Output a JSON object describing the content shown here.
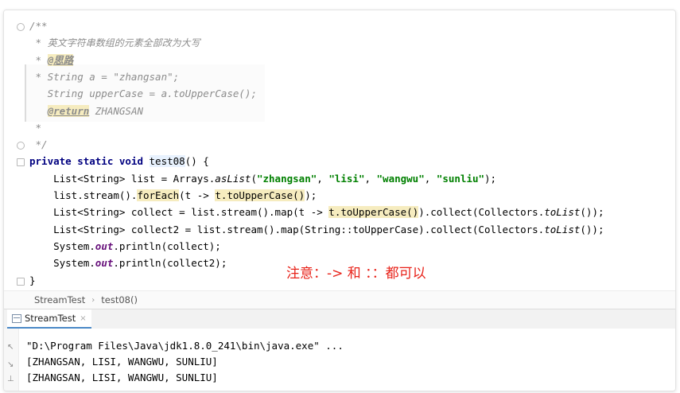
{
  "editor": {
    "lines": [
      {
        "parts": [
          {
            "t": "/**",
            "c": "doc"
          }
        ]
      },
      {
        "parts": [
          {
            "t": " * ",
            "c": "doc"
          },
          {
            "t": "英文字符串数组的元素全部改为大写",
            "c": "doc-cn"
          }
        ]
      },
      {
        "parts": [
          {
            "t": " * ",
            "c": "doc"
          },
          {
            "t": "@思路",
            "c": "doc-tag"
          }
        ]
      },
      {
        "parts": [
          {
            "t": " * String a = \"zhangsan\";",
            "c": "doc-code"
          }
        ]
      },
      {
        "parts": [
          {
            "t": "   String upperCase = a.toUpperCase();",
            "c": "doc-code"
          }
        ]
      },
      {
        "parts": [
          {
            "t": "   ",
            "c": "doc"
          },
          {
            "t": "@return",
            "c": "doc-tag"
          },
          {
            "t": " ZHANGSAN",
            "c": "doc"
          }
        ]
      },
      {
        "parts": [
          {
            "t": " *",
            "c": "doc"
          }
        ]
      },
      {
        "parts": [
          {
            "t": " */",
            "c": "doc"
          }
        ]
      },
      {
        "parts": [
          {
            "t": "private static void ",
            "c": "kw"
          },
          {
            "t": "test08",
            "c": "hl-m"
          },
          {
            "t": "() {",
            "c": ""
          }
        ]
      },
      {
        "parts": [
          {
            "t": "    List<String> list = Arrays.",
            "c": ""
          },
          {
            "t": "asList",
            "c": "static-m"
          },
          {
            "t": "(",
            "c": ""
          },
          {
            "t": "\"zhangsan\"",
            "c": "str"
          },
          {
            "t": ", ",
            "c": ""
          },
          {
            "t": "\"lisi\"",
            "c": "str"
          },
          {
            "t": ", ",
            "c": ""
          },
          {
            "t": "\"wangwu\"",
            "c": "str"
          },
          {
            "t": ", ",
            "c": ""
          },
          {
            "t": "\"sunliu\"",
            "c": "str"
          },
          {
            "t": ");",
            "c": ""
          }
        ]
      },
      {
        "parts": [
          {
            "t": "    list.stream().",
            "c": ""
          },
          {
            "t": "forEach",
            "c": "hl"
          },
          {
            "t": "(t -> ",
            "c": ""
          },
          {
            "t": "t.toUpperCase()",
            "c": "hl"
          },
          {
            "t": ");",
            "c": ""
          }
        ]
      },
      {
        "parts": [
          {
            "t": "    List<String> collect = list.stream().map(t -> ",
            "c": ""
          },
          {
            "t": "t.toUpperCase()",
            "c": "hl"
          },
          {
            "t": ").collect(Collectors.",
            "c": ""
          },
          {
            "t": "toList",
            "c": "static-m"
          },
          {
            "t": "());",
            "c": ""
          }
        ]
      },
      {
        "parts": [
          {
            "t": "    List<String> collect2 = list.stream().map(String::toUpperCase).collect(Collectors.",
            "c": ""
          },
          {
            "t": "toList",
            "c": "static-m"
          },
          {
            "t": "());",
            "c": ""
          }
        ]
      },
      {
        "parts": [
          {
            "t": "    System.",
            "c": ""
          },
          {
            "t": "out",
            "c": "field"
          },
          {
            "t": ".println(collect);",
            "c": ""
          }
        ]
      },
      {
        "parts": [
          {
            "t": "    System.",
            "c": ""
          },
          {
            "t": "out",
            "c": "field"
          },
          {
            "t": ".println(collect2);",
            "c": ""
          }
        ]
      },
      {
        "parts": [
          {
            "t": "}",
            "c": ""
          }
        ]
      }
    ]
  },
  "annotation": "注意：-> 和 ：：都可以",
  "breadcrumb": {
    "items": [
      "StreamTest",
      "test08()"
    ],
    "separator": "›"
  },
  "run": {
    "tab_label": "StreamTest",
    "tab_close": "×",
    "console": [
      "\"D:\\Program Files\\Java\\jdk1.8.0_241\\bin\\java.exe\" ...",
      "[ZHANGSAN, LISI, WANGWU, SUNLIU]",
      "[ZHANGSAN, LISI, WANGWU, SUNLIU]"
    ]
  },
  "colors": {
    "keyword": "#000080",
    "string": "#008000",
    "doc": "#8c8c8c",
    "annotation": "#e8231a",
    "highlight": "#f6ecbf"
  }
}
